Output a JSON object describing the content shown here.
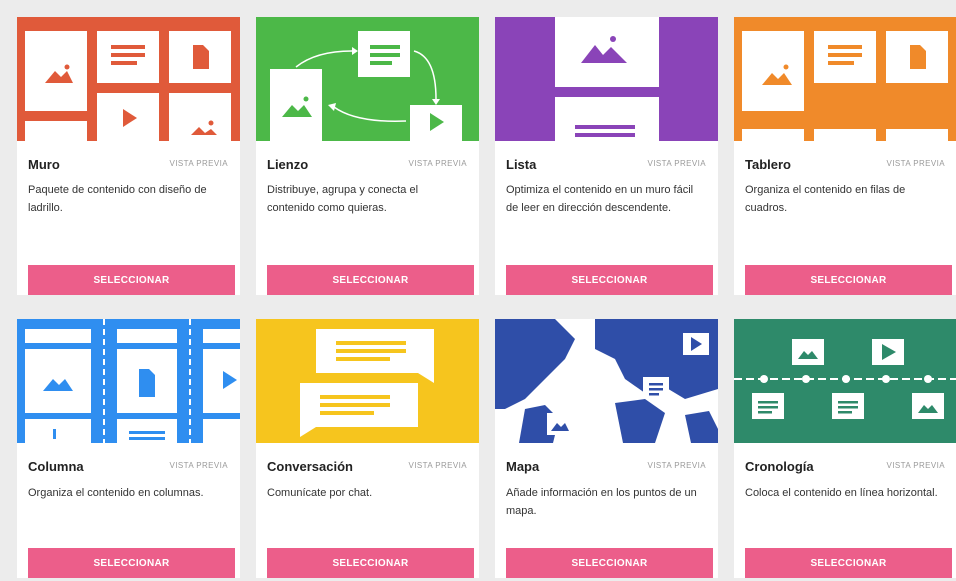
{
  "preview_label": "VISTA PREVIA",
  "select_label": "SELECCIONAR",
  "cards": [
    {
      "title": "Muro",
      "description": "Paquete de contenido con diseño de ladrillo.",
      "color": "#e05a3a"
    },
    {
      "title": "Lienzo",
      "description": "Distribuye, agrupa y conecta el contenido como quieras.",
      "color": "#4cb848"
    },
    {
      "title": "Lista",
      "description": "Optimiza el contenido en un muro fácil de leer en dirección descendente.",
      "color": "#8a44b8"
    },
    {
      "title": "Tablero",
      "description": "Organiza el contenido en filas de cuadros.",
      "color": "#f08a2a"
    },
    {
      "title": "Columna",
      "description": "Organiza el contenido en columnas.",
      "color": "#2f8ef0"
    },
    {
      "title": "Conversación",
      "description": "Comunícate por chat.",
      "color": "#f6c51e"
    },
    {
      "title": "Mapa",
      "description": "Añade información en los puntos de un mapa.",
      "color": "#2f4ea8"
    },
    {
      "title": "Cronología",
      "description": "Coloca el contenido en línea horizontal.",
      "color": "#2e8a6a"
    }
  ]
}
